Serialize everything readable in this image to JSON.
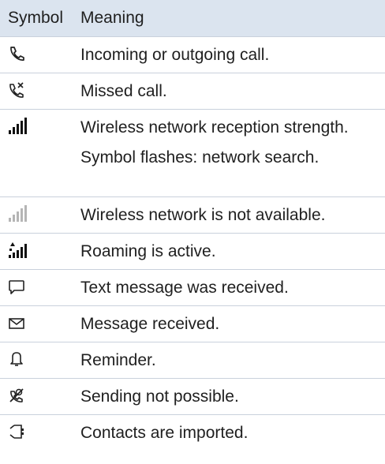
{
  "header": {
    "symbol": "Symbol",
    "meaning": "Meaning"
  },
  "rows": [
    {
      "icon": "phone-handset-icon",
      "meaning": [
        "Incoming or outgoing call."
      ]
    },
    {
      "icon": "missed-call-icon",
      "meaning": [
        "Missed call."
      ]
    },
    {
      "icon": "signal-strength-icon",
      "meaning": [
        "Wireless network reception strength.",
        "Symbol flashes: network search."
      ]
    },
    {
      "icon": "signal-unavailable-icon",
      "meaning": [
        "Wireless network is not available."
      ]
    },
    {
      "icon": "roaming-icon",
      "meaning": [
        "Roaming is active."
      ]
    },
    {
      "icon": "speech-bubble-icon",
      "meaning": [
        "Text message was received."
      ]
    },
    {
      "icon": "envelope-icon",
      "meaning": [
        "Message received."
      ]
    },
    {
      "icon": "bell-icon",
      "meaning": [
        "Reminder."
      ]
    },
    {
      "icon": "sending-blocked-icon",
      "meaning": [
        "Sending not possible."
      ]
    },
    {
      "icon": "contacts-import-icon",
      "meaning": [
        "Contacts are imported."
      ]
    }
  ]
}
